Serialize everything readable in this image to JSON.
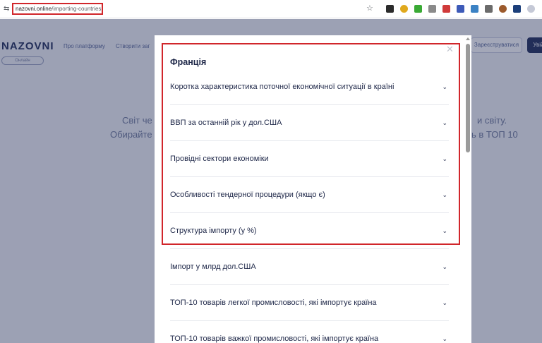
{
  "browser": {
    "url_domain": "nazovni.online",
    "url_path": "/importing-countries"
  },
  "background_page": {
    "logo": "NAZOVNI",
    "logo_sub": "Онлайн",
    "nav": [
      "Про платформу",
      "Створити заг"
    ],
    "register_button": "Зареєструватися",
    "login_button": "Увійти",
    "hero_line1_left": "Світ че",
    "hero_line1_right": "и світу.",
    "hero_line2_left": "Обирайте",
    "hero_line2_right": "ь в ТОП 10"
  },
  "modal": {
    "country": "Франція",
    "close_icon": "close-icon",
    "chevron_icon": "chevron-down-icon",
    "sections": [
      {
        "label": "Коротка характеристика поточної економічної ситуації в країні"
      },
      {
        "label": "ВВП за останній рік у дол.США"
      },
      {
        "label": "Провідні сектори економіки"
      },
      {
        "label": "Особливості тендерної процедури (якщо є)"
      },
      {
        "label": "Структура імпорту (у %)"
      },
      {
        "label": "Імпорт у млрд дол.США"
      },
      {
        "label": "ТОП-10 товарів легкої промисловості, які імпортує країна"
      },
      {
        "label": "ТОП-10 товарів важкої промисловості, які імпортує країна"
      }
    ]
  },
  "colors": {
    "highlight": "#d1262b",
    "text_dark": "#1e2748"
  }
}
